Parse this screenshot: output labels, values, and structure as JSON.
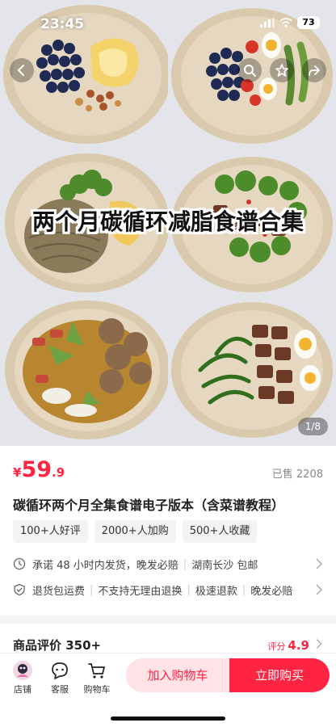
{
  "status_bar": {
    "time": "23:45",
    "battery": "73"
  },
  "hero": {
    "overlay_title": "两个月碳循环减脂食谱合集",
    "page_indicator": "1/8",
    "icons": [
      "back-icon",
      "search-icon",
      "star-icon",
      "share-icon"
    ]
  },
  "product": {
    "price_currency": "¥",
    "price_integer": "59",
    "price_decimal": ".9",
    "sold_text": "已售 2208",
    "title": "碳循环两个月全集食谱电子版本（含菜谱教程）",
    "tags": [
      "100+人好评",
      "2000+人加购",
      "500+人收藏"
    ],
    "shipping_text": "承诺 48 小时内发货，晚发必赔",
    "shipping_location": "湖南长沙 包邮",
    "guarantees": [
      "退货包运费",
      "不支持无理由退换",
      "极速退款",
      "晚发必赔"
    ]
  },
  "reviews": {
    "title": "商品评价 350+",
    "rating_label": "评分",
    "rating_value": "4.9"
  },
  "bottom_bar": {
    "store_label": "店铺",
    "service_label": "客服",
    "cart_label": "购物车",
    "add_cart_button": "加入购物车",
    "buy_now_button": "立即购买"
  },
  "colors": {
    "accent": "#ff2442",
    "accent_light": "#ffe3e6"
  }
}
